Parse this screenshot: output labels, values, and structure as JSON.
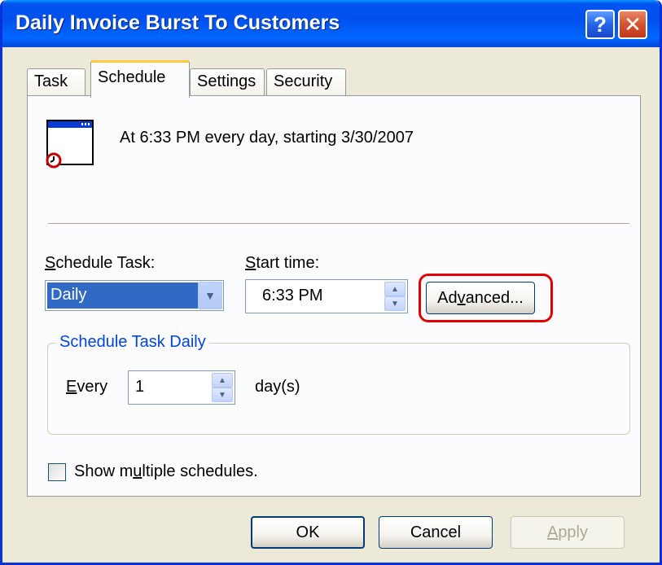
{
  "window": {
    "title": "Daily Invoice Burst To Customers",
    "help_glyph": "?",
    "close_glyph": "✕"
  },
  "tabs": [
    {
      "label": "Task",
      "active": false
    },
    {
      "label": "Schedule",
      "active": true
    },
    {
      "label": "Settings",
      "active": false
    },
    {
      "label": "Security",
      "active": false
    }
  ],
  "schedule": {
    "summary": "At 6:33 PM every day, starting 3/30/2007",
    "schedule_task_label_accel": "S",
    "schedule_task_label_rest": "chedule Task:",
    "schedule_task_value": "Daily",
    "start_time_label_accel": "S",
    "start_time_label_rest": "tart time:",
    "start_time_value": "6:33 PM",
    "advanced_pre": "Ad",
    "advanced_accel": "v",
    "advanced_post": "anced..."
  },
  "daily_group": {
    "title": "Schedule Task Daily",
    "every_accel": "E",
    "every_rest": "very",
    "every_value": "1",
    "unit": "day(s)"
  },
  "multiple": {
    "label_pre": "Show m",
    "label_accel": "u",
    "label_post": "ltiple schedules.",
    "checked": false
  },
  "footer": {
    "ok_label": "OK",
    "cancel_label": "Cancel",
    "apply_accel": "A",
    "apply_rest": "pply"
  },
  "colors": {
    "titlebar": "#0054e3",
    "dialog_bg": "#ece9d8",
    "selection": "#316ac5",
    "group_title": "#0046d5",
    "highlight": "#e10000"
  }
}
